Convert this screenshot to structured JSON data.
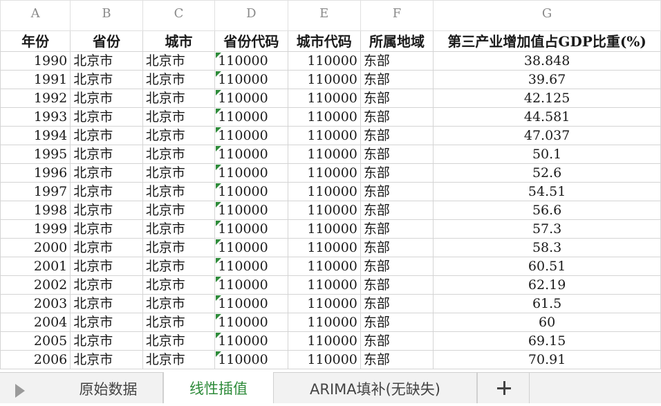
{
  "columns": [
    "A",
    "B",
    "C",
    "D",
    "E",
    "F",
    "G"
  ],
  "headers": [
    "年份",
    "省份",
    "城市",
    "省份代码",
    "城市代码",
    "所属地域",
    "第三产业增加值占GDP比重(%)"
  ],
  "rows": [
    [
      "1990",
      "北京市",
      "北京市",
      "110000",
      "110000",
      "东部",
      "38.848"
    ],
    [
      "1991",
      "北京市",
      "北京市",
      "110000",
      "110000",
      "东部",
      "39.67"
    ],
    [
      "1992",
      "北京市",
      "北京市",
      "110000",
      "110000",
      "东部",
      "42.125"
    ],
    [
      "1993",
      "北京市",
      "北京市",
      "110000",
      "110000",
      "东部",
      "44.581"
    ],
    [
      "1994",
      "北京市",
      "北京市",
      "110000",
      "110000",
      "东部",
      "47.037"
    ],
    [
      "1995",
      "北京市",
      "北京市",
      "110000",
      "110000",
      "东部",
      "50.1"
    ],
    [
      "1996",
      "北京市",
      "北京市",
      "110000",
      "110000",
      "东部",
      "52.6"
    ],
    [
      "1997",
      "北京市",
      "北京市",
      "110000",
      "110000",
      "东部",
      "54.51"
    ],
    [
      "1998",
      "北京市",
      "北京市",
      "110000",
      "110000",
      "东部",
      "56.6"
    ],
    [
      "1999",
      "北京市",
      "北京市",
      "110000",
      "110000",
      "东部",
      "57.3"
    ],
    [
      "2000",
      "北京市",
      "北京市",
      "110000",
      "110000",
      "东部",
      "58.3"
    ],
    [
      "2001",
      "北京市",
      "北京市",
      "110000",
      "110000",
      "东部",
      "60.51"
    ],
    [
      "2002",
      "北京市",
      "北京市",
      "110000",
      "110000",
      "东部",
      "62.19"
    ],
    [
      "2003",
      "北京市",
      "北京市",
      "110000",
      "110000",
      "东部",
      "61.5"
    ],
    [
      "2004",
      "北京市",
      "北京市",
      "110000",
      "110000",
      "东部",
      "60"
    ],
    [
      "2005",
      "北京市",
      "北京市",
      "110000",
      "110000",
      "东部",
      "69.15"
    ],
    [
      "2006",
      "北京市",
      "北京市",
      "110000",
      "110000",
      "东部",
      "70.91"
    ]
  ],
  "tabs": [
    "原始数据",
    "线性插值",
    "ARIMA填补(无缺失)"
  ],
  "active_tab": "线性插值",
  "colors": {
    "accent": "#2e8b3a",
    "gridline": "#d4d4d4",
    "tabbar": "#f2f2f2"
  },
  "icons": {
    "nav": "play-triangle-icon",
    "add": "plus-icon"
  }
}
